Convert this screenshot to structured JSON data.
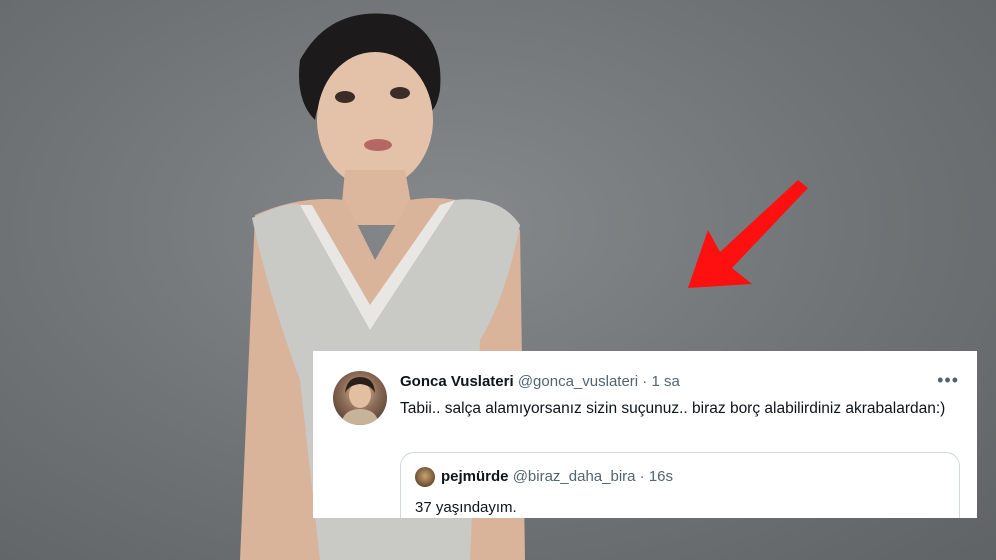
{
  "tweet": {
    "author_name": "Gonca Vuslateri",
    "author_handle": "@gonca_vuslateri",
    "separator": "·",
    "time": "1 sa",
    "more_label": "•••",
    "text": "Tabii.. salça alamıyorsanız sizin suçunuz.. biraz borç alabilirdiniz akrabalardan:)",
    "quoted": {
      "author_name": "pejmürde",
      "author_handle": "@biraz_daha_bira",
      "separator": "·",
      "time": "16s",
      "text": "37 yaşındayım."
    }
  },
  "colors": {
    "arrow": "#ff1010",
    "background": "#6e7275",
    "card": "#ffffff",
    "secondary_text": "#536471"
  },
  "icons": [
    "red-arrow-icon",
    "more-options-icon"
  ]
}
